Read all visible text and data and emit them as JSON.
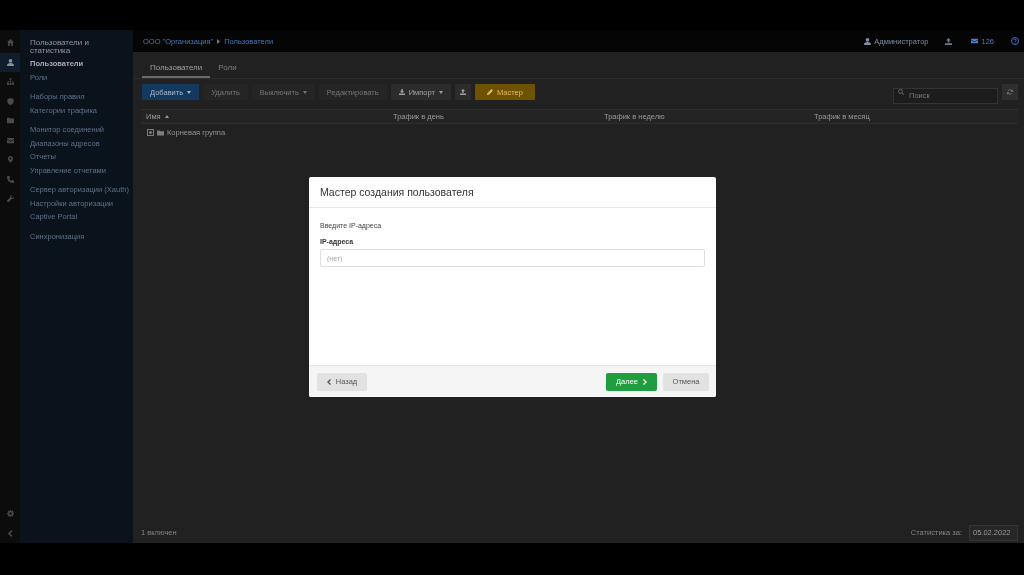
{
  "rail": {
    "items": [
      {
        "kind": "home",
        "selected": false
      },
      {
        "kind": "user",
        "selected": true
      },
      {
        "kind": "sitemap",
        "selected": false
      },
      {
        "kind": "shield",
        "selected": false
      },
      {
        "kind": "folder",
        "selected": false
      },
      {
        "kind": "envelope",
        "selected": false
      },
      {
        "kind": "map-pin",
        "selected": false
      },
      {
        "kind": "phone",
        "selected": false
      },
      {
        "kind": "wrench",
        "selected": false
      }
    ],
    "bottom_items": [
      {
        "kind": "gear"
      },
      {
        "kind": "chevron-left"
      }
    ]
  },
  "sidebar": {
    "title": "Пользователи и статистика",
    "groups": [
      {
        "items": [
          {
            "label": "Пользователи",
            "selected": true
          },
          {
            "label": "Роли",
            "selected": false
          }
        ]
      },
      {
        "items": [
          {
            "label": "Наборы правил",
            "selected": false
          },
          {
            "label": "Категории трафика",
            "selected": false
          }
        ]
      },
      {
        "items": [
          {
            "label": "Монитор соединений",
            "selected": false
          },
          {
            "label": "Диапазоны адресов",
            "selected": false
          },
          {
            "label": "Отчеты",
            "selected": false
          },
          {
            "label": "Управление отчетами",
            "selected": false
          }
        ]
      },
      {
        "items": [
          {
            "label": "Сервер авторизации (Xauth)",
            "selected": false
          },
          {
            "label": "Настройки авторизации",
            "selected": false
          },
          {
            "label": "Captive Portal",
            "selected": false
          }
        ]
      },
      {
        "items": [
          {
            "label": "Синхронизация",
            "selected": false
          }
        ]
      }
    ]
  },
  "header": {
    "breadcrumb": [
      "ООО \"Организация\"",
      "Пользователи"
    ],
    "user": "Администратор",
    "messages": "126"
  },
  "tabs": [
    {
      "label": "Пользователи",
      "selected": true
    },
    {
      "label": "Роли",
      "selected": false
    }
  ],
  "toolbar": {
    "buttons": [
      {
        "kind": "primary",
        "label": "Добавить",
        "dropdown": true,
        "disabled": false
      },
      {
        "kind": "plain",
        "label": "Удалить",
        "dropdown": false,
        "disabled": true
      },
      {
        "kind": "plain",
        "label": "Выключить",
        "dropdown": true,
        "disabled": true
      },
      {
        "kind": "plain",
        "label": "Редактировать",
        "dropdown": false,
        "disabled": true
      },
      {
        "kind": "import",
        "label": "Импорт",
        "dropdown": true,
        "disabled": false
      },
      {
        "kind": "export",
        "dropdown": false,
        "disabled": false
      },
      {
        "kind": "wizard",
        "label": "Мастер",
        "dropdown": false,
        "disabled": false
      }
    ],
    "search": {
      "placeholder": "Поиск"
    }
  },
  "table": {
    "columns": [
      {
        "label": "Имя",
        "sorted": true
      },
      {
        "label": "Трафик в день",
        "sorted": false
      },
      {
        "label": "Трафик в неделю",
        "sorted": false
      },
      {
        "label": "Трафик в месяц",
        "sorted": false
      }
    ],
    "rows": [
      {
        "name": "Корневая группа",
        "expanded": false
      }
    ]
  },
  "status_bar": {
    "summary": "1 включен",
    "stats_label": "Статистика за:",
    "date": "05.02.2022"
  },
  "dialog": {
    "title": "Мастер создания пользователя",
    "prompt": "Введите IP-адреса",
    "field": {
      "label": "IP-адреса",
      "placeholder": "(нет)"
    },
    "buttons": [
      {
        "kind": "back",
        "label": "Назад"
      },
      {
        "kind": "next",
        "label": "Далее"
      },
      {
        "kind": "cancel",
        "label": "Отмена"
      }
    ]
  }
}
